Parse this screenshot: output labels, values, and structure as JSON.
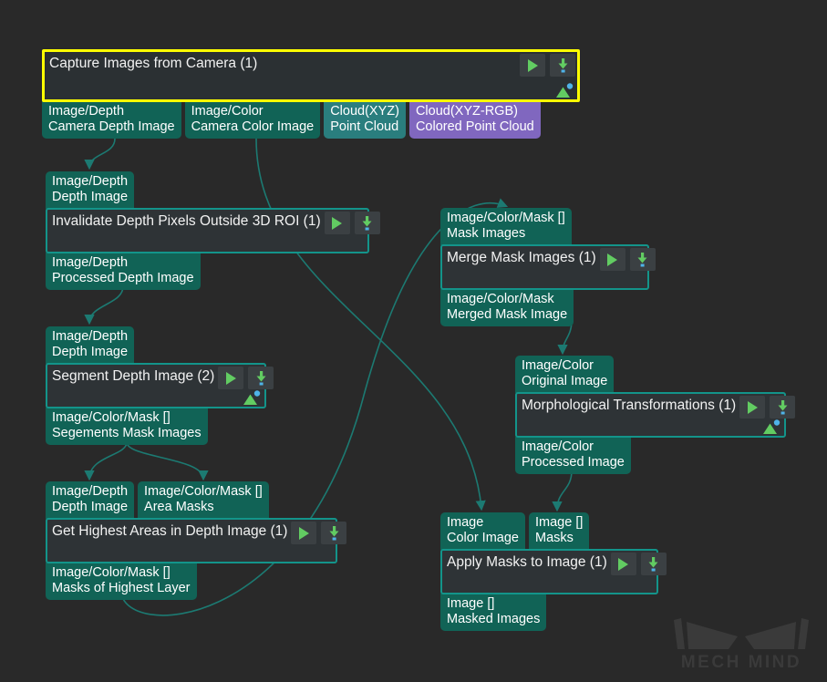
{
  "canvas": {
    "background_color": "#292929",
    "watermark_text": "MECH MIND",
    "watermark_name": "mech-mind-logo"
  },
  "colors": {
    "node_body": "#2e3336",
    "node_border": "#13948a",
    "node_selected_border": "#ffff00",
    "port_teal": "#116356",
    "port_teal_light": "#2a7e7e",
    "port_purple": "#8067bf",
    "edge": "#1c7a72",
    "play_green": "#62cc62",
    "download_green": "#62cc62",
    "download_blue": "#4fb3e8"
  },
  "icons": {
    "play": "play-icon",
    "download": "download-icon",
    "preview": "image-preview-icon"
  },
  "nodes": [
    {
      "id": "capture",
      "title": "Capture Images from Camera (1)",
      "selected": true,
      "has_preview": true,
      "inputs": [],
      "outputs": [
        {
          "type": "Image/Depth",
          "name": "Camera Depth Image",
          "style": "teal"
        },
        {
          "type": "Image/Color",
          "name": "Camera Color Image",
          "style": "teal"
        },
        {
          "type": "Cloud(XYZ)",
          "name": "Point Cloud",
          "style": "teal-light"
        },
        {
          "type": "Cloud(XYZ-RGB)",
          "name": "Colored Point Cloud",
          "style": "purple"
        }
      ]
    },
    {
      "id": "invalidate",
      "title": "Invalidate Depth Pixels Outside 3D ROI (1)",
      "selected": false,
      "has_preview": false,
      "inputs": [
        {
          "type": "Image/Depth",
          "name": "Depth Image",
          "style": "teal"
        }
      ],
      "outputs": [
        {
          "type": "Image/Depth",
          "name": "Processed Depth Image",
          "style": "teal"
        }
      ]
    },
    {
      "id": "segment",
      "title": "Segment Depth Image (2)",
      "selected": false,
      "has_preview": true,
      "inputs": [
        {
          "type": "Image/Depth",
          "name": "Depth Image",
          "style": "teal"
        }
      ],
      "outputs": [
        {
          "type": "Image/Color/Mask []",
          "name": "Segements Mask Images",
          "style": "teal"
        }
      ]
    },
    {
      "id": "highest",
      "title": "Get Highest Areas in Depth Image (1)",
      "selected": false,
      "has_preview": false,
      "inputs": [
        {
          "type": "Image/Depth",
          "name": "Depth Image",
          "style": "teal"
        },
        {
          "type": "Image/Color/Mask []",
          "name": "Area Masks",
          "style": "teal"
        }
      ],
      "outputs": [
        {
          "type": "Image/Color/Mask []",
          "name": "Masks of Highest Layer",
          "style": "teal"
        }
      ]
    },
    {
      "id": "merge",
      "title": "Merge Mask Images (1)",
      "selected": false,
      "has_preview": false,
      "inputs": [
        {
          "type": "Image/Color/Mask []",
          "name": "Mask Images",
          "style": "teal"
        }
      ],
      "outputs": [
        {
          "type": "Image/Color/Mask",
          "name": "Merged Mask Image",
          "style": "teal"
        }
      ]
    },
    {
      "id": "morph",
      "title": "Morphological Transformations (1)",
      "selected": false,
      "has_preview": true,
      "inputs": [
        {
          "type": "Image/Color",
          "name": "Original Image",
          "style": "teal"
        }
      ],
      "outputs": [
        {
          "type": "Image/Color",
          "name": "Processed Image",
          "style": "teal"
        }
      ]
    },
    {
      "id": "apply",
      "title": "Apply Masks to Image (1)",
      "selected": false,
      "has_preview": false,
      "inputs": [
        {
          "type": "Image",
          "name": "Color Image",
          "style": "teal"
        },
        {
          "type": "Image []",
          "name": "Masks",
          "style": "teal"
        }
      ],
      "outputs": [
        {
          "type": "Image []",
          "name": "Masked Images",
          "style": "teal"
        }
      ]
    }
  ],
  "edges": [
    {
      "from": "capture.Camera Depth Image",
      "to": "invalidate.Depth Image"
    },
    {
      "from": "invalidate.Processed Depth Image",
      "to": "segment.Depth Image"
    },
    {
      "from": "segment.Segements Mask Images",
      "to": "highest.Depth Image"
    },
    {
      "from": "segment.Segements Mask Images",
      "to": "highest.Area Masks"
    },
    {
      "from": "capture.Camera Color Image",
      "to": "apply.Color Image"
    },
    {
      "from": "highest.Masks of Highest Layer",
      "to": "merge.Mask Images"
    },
    {
      "from": "merge.Merged Mask Image",
      "to": "morph.Original Image"
    },
    {
      "from": "morph.Processed Image",
      "to": "apply.Masks"
    }
  ]
}
